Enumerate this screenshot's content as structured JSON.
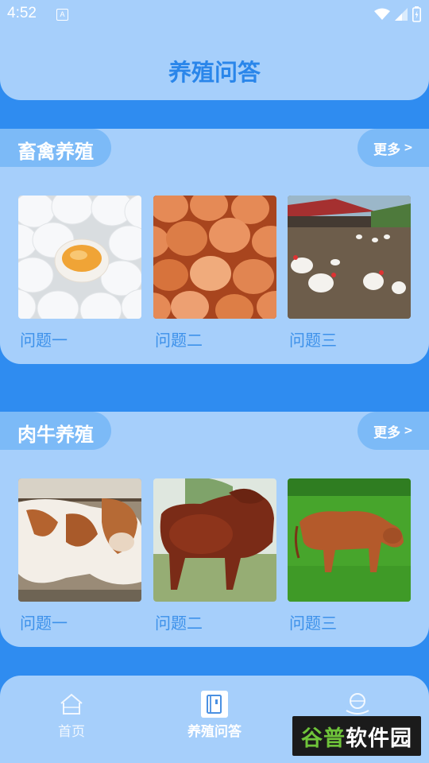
{
  "status": {
    "time": "4:52",
    "notif_glyph": "A"
  },
  "header": {
    "title": "养殖问答"
  },
  "sections": [
    {
      "title": "畜禽养殖",
      "more": "更多",
      "items": [
        {
          "label": "问题一",
          "image": "white-eggs-image"
        },
        {
          "label": "问题二",
          "image": "brown-eggs-image"
        },
        {
          "label": "问题三",
          "image": "chickens-farm-image"
        }
      ]
    },
    {
      "title": "肉牛养殖",
      "more": "更多",
      "items": [
        {
          "label": "问题一",
          "image": "cattle-pen-image"
        },
        {
          "label": "问题二",
          "image": "brown-bull-image"
        },
        {
          "label": "问题三",
          "image": "cow-grass-image"
        }
      ]
    }
  ],
  "tabbar": {
    "tabs": [
      {
        "label": "首页",
        "icon": "home-icon",
        "active": false
      },
      {
        "label": "养殖问答",
        "icon": "qa-book-icon",
        "active": true
      },
      {
        "label": "",
        "icon": "profile-icon",
        "active": false
      }
    ]
  },
  "watermark": {
    "part1": "谷普",
    "part2": "软件园"
  },
  "colors": {
    "background": "#2f8cf0",
    "panel": "#a6cffb",
    "tab_pill": "#7cbaf7",
    "title_blue": "#2a86ea",
    "label_blue": "#3d91ea"
  }
}
